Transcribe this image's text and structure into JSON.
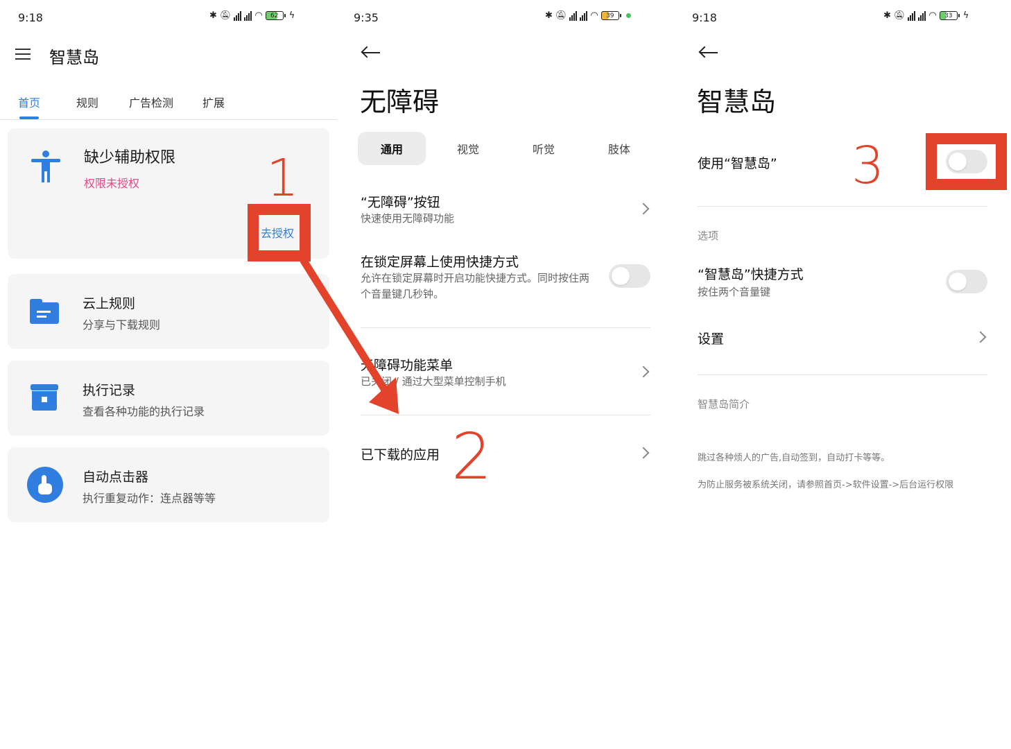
{
  "panel1": {
    "status": {
      "time": "9:18",
      "battery": "62"
    },
    "title": "智慧岛",
    "tabs": [
      "首页",
      "规则",
      "广告检测",
      "扩展"
    ],
    "permission_card": {
      "title": "缺少辅助权限",
      "subtitle": "权限未授权",
      "action": "去授权"
    },
    "cards": [
      {
        "title": "云上规则",
        "subtitle": "分享与下载规则"
      },
      {
        "title": "执行记录",
        "subtitle": "查看各种功能的执行记录"
      },
      {
        "title": "自动点击器",
        "subtitle": "执行重复动作：连点器等等"
      }
    ]
  },
  "panel2": {
    "status": {
      "time": "9:35",
      "battery": "39"
    },
    "title": "无障碍",
    "tabs": [
      "通用",
      "视觉",
      "听觉",
      "肢体"
    ],
    "rows": [
      {
        "title": "“无障碍”按钮",
        "subtitle": "快速使用无障碍功能"
      },
      {
        "title": "在锁定屏幕上使用快捷方式",
        "subtitle": "允许在锁定屏幕时开启功能快捷方式。同时按住两个音量键几秒钟。"
      },
      {
        "title": "无障碍功能菜单",
        "subtitle": "已关闭 / 通过大型菜单控制手机"
      },
      {
        "title": "已下载的应用"
      }
    ]
  },
  "panel3": {
    "status": {
      "time": "9:18",
      "battery": "33"
    },
    "title": "智慧岛",
    "use_label": "使用“智慧岛”",
    "section_options": "选项",
    "shortcut_title": "“智慧岛”快捷方式",
    "shortcut_sub": "按住两个音量键",
    "settings_label": "设置",
    "section_intro": "智慧岛简介",
    "intro_line1": "跳过各种烦人的广告,自动签到，自动打卡等等。",
    "intro_line2": "为防止服务被系统关闭，请参照首页->软件设置->后台运行权限"
  },
  "annotations": {
    "step1": "1",
    "step2": "2",
    "step3": "3"
  },
  "colors": {
    "accent_blue": "#2f7ee0",
    "annotation_red": "#e2432a",
    "pink_text": "#e04a8a"
  },
  "icons": [
    "menu-icon",
    "accessibility-icon",
    "folder-icon",
    "archive-icon",
    "touch-icon",
    "back-arrow-icon",
    "chevron-right-icon"
  ]
}
